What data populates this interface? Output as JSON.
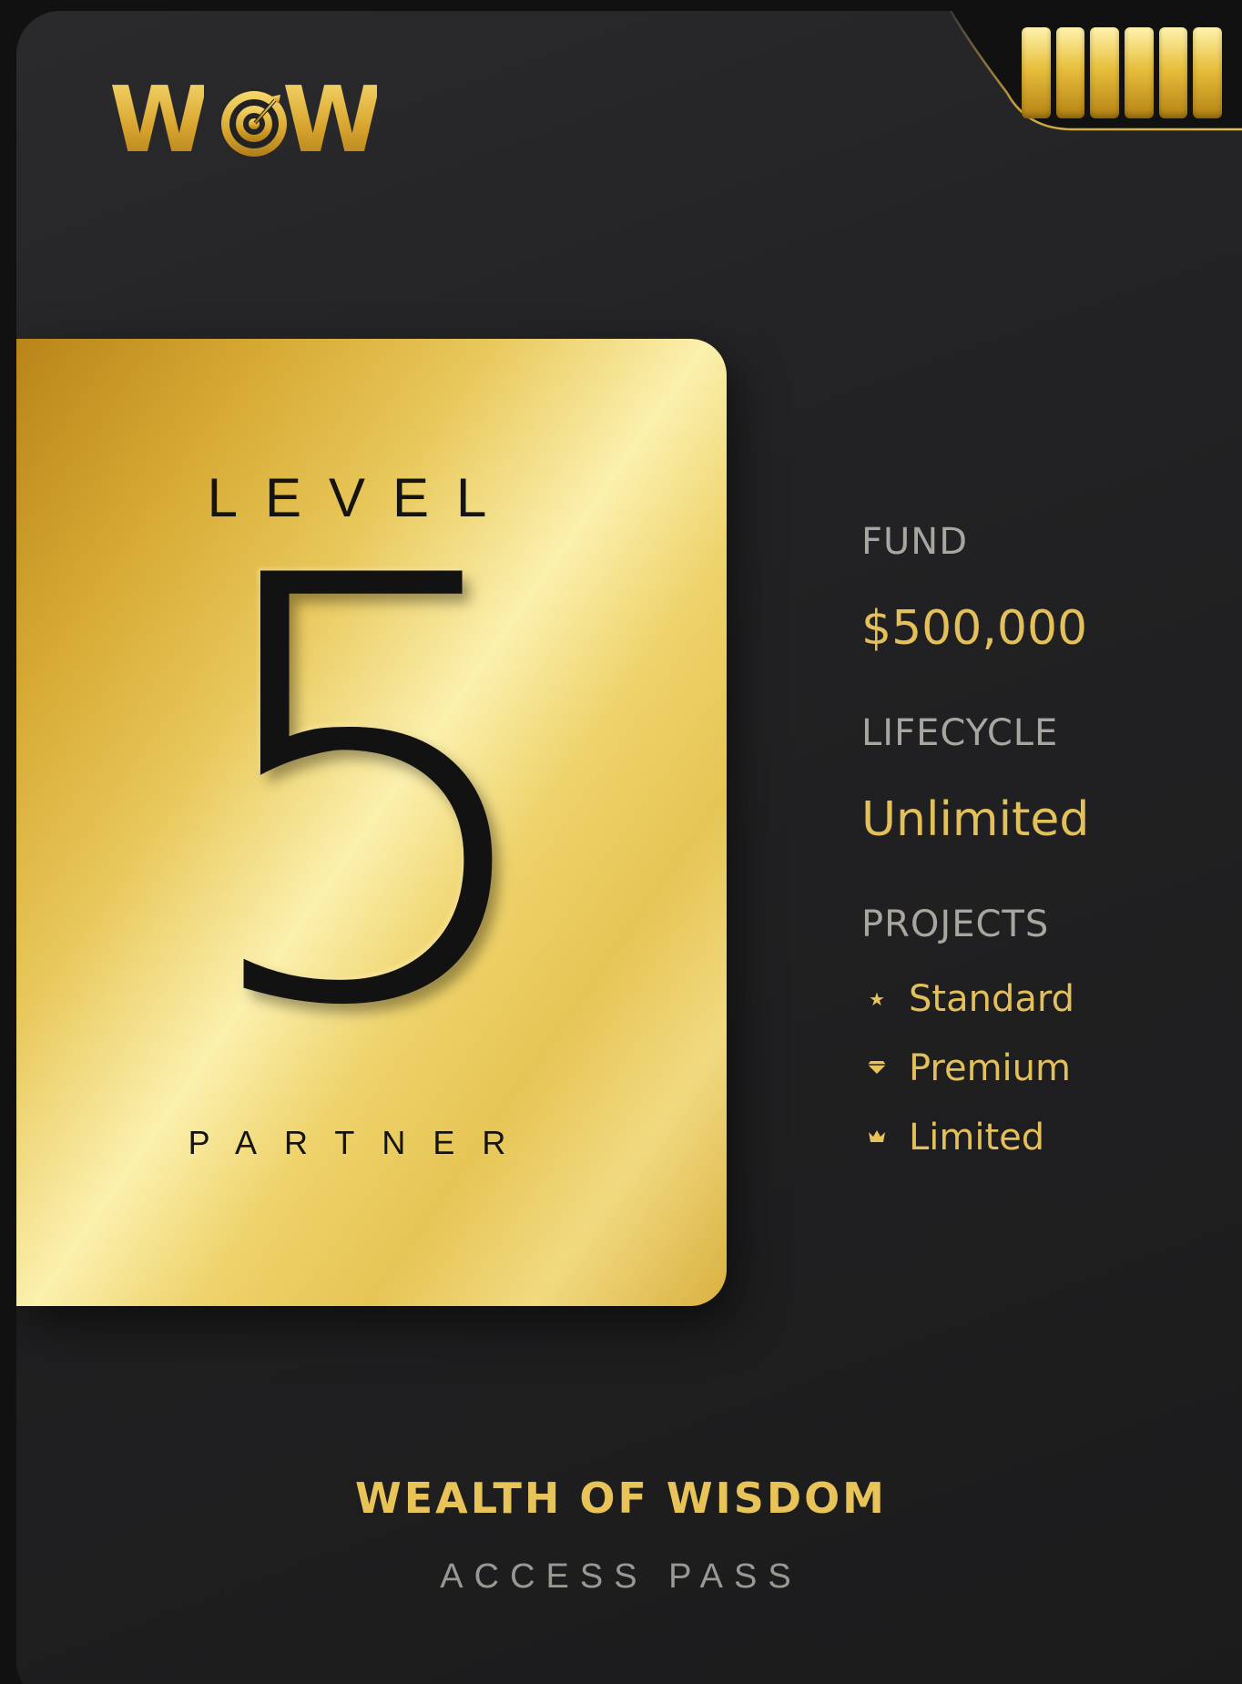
{
  "brand": {
    "logo_text_left": "W",
    "logo_text_right": "W",
    "logo_center_icon": "target-icon",
    "gold": "#e4c05a",
    "gold_light": "#fbf0ad",
    "gold_dark": "#b98419",
    "card_bg": "#222224"
  },
  "battery": {
    "icon": "battery-icon",
    "segments": 6
  },
  "level_card": {
    "label": "LEVEL",
    "number": "5",
    "role": "PARTNER"
  },
  "details": {
    "fund_label": "FUND",
    "fund_value": "$500,000",
    "lifecycle_label": "LIFECYCLE",
    "lifecycle_value": "Unlimited",
    "projects_label": "PROJECTS",
    "projects": [
      {
        "icon": "star-icon",
        "label": "Standard"
      },
      {
        "icon": "diamond-icon",
        "label": "Premium"
      },
      {
        "icon": "crown-icon",
        "label": "Limited"
      }
    ]
  },
  "footer": {
    "title": "WEALTH OF WISDOM",
    "subtitle": "ACCESS PASS"
  }
}
